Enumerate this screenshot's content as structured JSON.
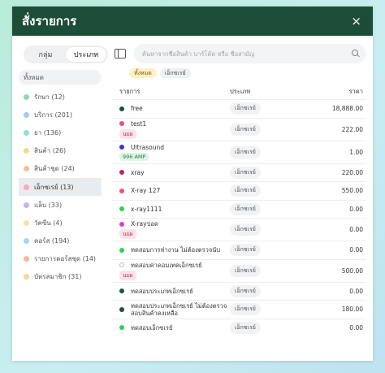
{
  "modal": {
    "title": "สั่งรายการ",
    "close": "×"
  },
  "sidebar": {
    "toggle": [
      {
        "label": "กลุ่ม",
        "active": false
      },
      {
        "label": "ประเภท",
        "active": true
      }
    ],
    "all_label": "ทั้งหมด",
    "categories": [
      {
        "label": "รักษา (12)",
        "color": "#8fd9b6",
        "active": false
      },
      {
        "label": "บริการ (201)",
        "color": "#a9c6f5",
        "active": false
      },
      {
        "label": "ยา (136)",
        "color": "#8fe0d2",
        "active": false
      },
      {
        "label": "สินค้า (26)",
        "color": "#f6d98a",
        "active": false
      },
      {
        "label": "สินค้าชุด (24)",
        "color": "#f4bf96",
        "active": false
      },
      {
        "label": "เอ็กซเรย์ (13)",
        "color": "#f6a9c2",
        "active": true
      },
      {
        "label": "แล็บ (33)",
        "color": "#c5b4f1",
        "active": false
      },
      {
        "label": "วัคซีน (4)",
        "color": "#f7e39a",
        "active": false
      },
      {
        "label": "คอร์ส (194)",
        "color": "#9fd7f4",
        "active": false
      },
      {
        "label": "รายการคอร์สชุด (14)",
        "color": "#f4b8a0",
        "active": false
      },
      {
        "label": "บัตรสมาชิก (31)",
        "color": "#f5d59a",
        "active": false
      }
    ]
  },
  "search": {
    "placeholder": "ค้นหาจากชื่อสินค้า บาร์โค้ด หรือ ชื่อสามัญ",
    "value": ""
  },
  "filters": [
    {
      "label": "ทั้งหมด",
      "style": "yellow"
    },
    {
      "label": "เอ็กซเรย์",
      "style": "gray"
    }
  ],
  "table": {
    "headers": {
      "name": "รายการ",
      "type": "ประเภท",
      "price": "ราคา"
    },
    "rows": [
      {
        "name": "free",
        "dot": "#1f5040",
        "hollow": false,
        "sub": "",
        "sub_style": "",
        "type": "เอ็กซเรย์",
        "price": "18,888.00"
      },
      {
        "name": "test1",
        "dot": "#e94f8c",
        "hollow": false,
        "sub": "นมผ",
        "sub_style": "pink",
        "type": "เอ็กซเรย์",
        "price": "222.00"
      },
      {
        "name": "Ultrasound",
        "dot": "#3a34d6",
        "hollow": false,
        "sub": "996 AMP",
        "sub_style": "green",
        "type": "เอ็กซเรย์",
        "price": "1.00"
      },
      {
        "name": "xray",
        "dot": "#b9206a",
        "hollow": false,
        "sub": "",
        "sub_style": "",
        "type": "เอ็กซเรย์",
        "price": "220.00"
      },
      {
        "name": "X-ray 127",
        "dot": "#e94f8c",
        "hollow": false,
        "sub": "",
        "sub_style": "",
        "type": "เอ็กซเรย์",
        "price": "550.00"
      },
      {
        "name": "x-ray1111",
        "dot": "#2bd15a",
        "hollow": false,
        "sub": "",
        "sub_style": "",
        "type": "เอ็กซเรย์",
        "price": "0.00"
      },
      {
        "name": "X-rayปอด",
        "dot": "#d63fcf",
        "hollow": false,
        "sub": "นมผ",
        "sub_style": "pink",
        "type": "เอ็กซเรย์",
        "price": "0.00"
      },
      {
        "name": "ทดสอบการห่างาน ไม่ต้องตรวจนับ",
        "dot": "#2bd15a",
        "hollow": false,
        "sub": "",
        "sub_style": "",
        "type": "เอ็กซเรย์",
        "price": "0.00"
      },
      {
        "name": "ทดสอบค่าคอมเทคเอ็กซเรย์",
        "dot": "#ffffff",
        "hollow": true,
        "sub": "นมผ",
        "sub_style": "pink",
        "type": "เอ็กซเรย์",
        "price": "500.00"
      },
      {
        "name": "ทดสอบประเภทเอ็กซเรย์",
        "dot": "#1f5040",
        "hollow": false,
        "sub": "",
        "sub_style": "",
        "type": "เอ็กซเรย์",
        "price": "0.00"
      },
      {
        "name": "ทดสอบประเภทเอ็กซเรย์ ไม่ต้องตรวจสอบสินค้าคงเหลือ",
        "dot": "#1f5040",
        "hollow": false,
        "sub": "",
        "sub_style": "",
        "type": "เอ็กซเรย์",
        "price": "180.00"
      },
      {
        "name": "ทดสอบเอ็กซเรย์",
        "dot": "#2bd15a",
        "hollow": false,
        "sub": "",
        "sub_style": "",
        "type": "เอ็กซเรย์",
        "price": "0.00"
      }
    ]
  }
}
